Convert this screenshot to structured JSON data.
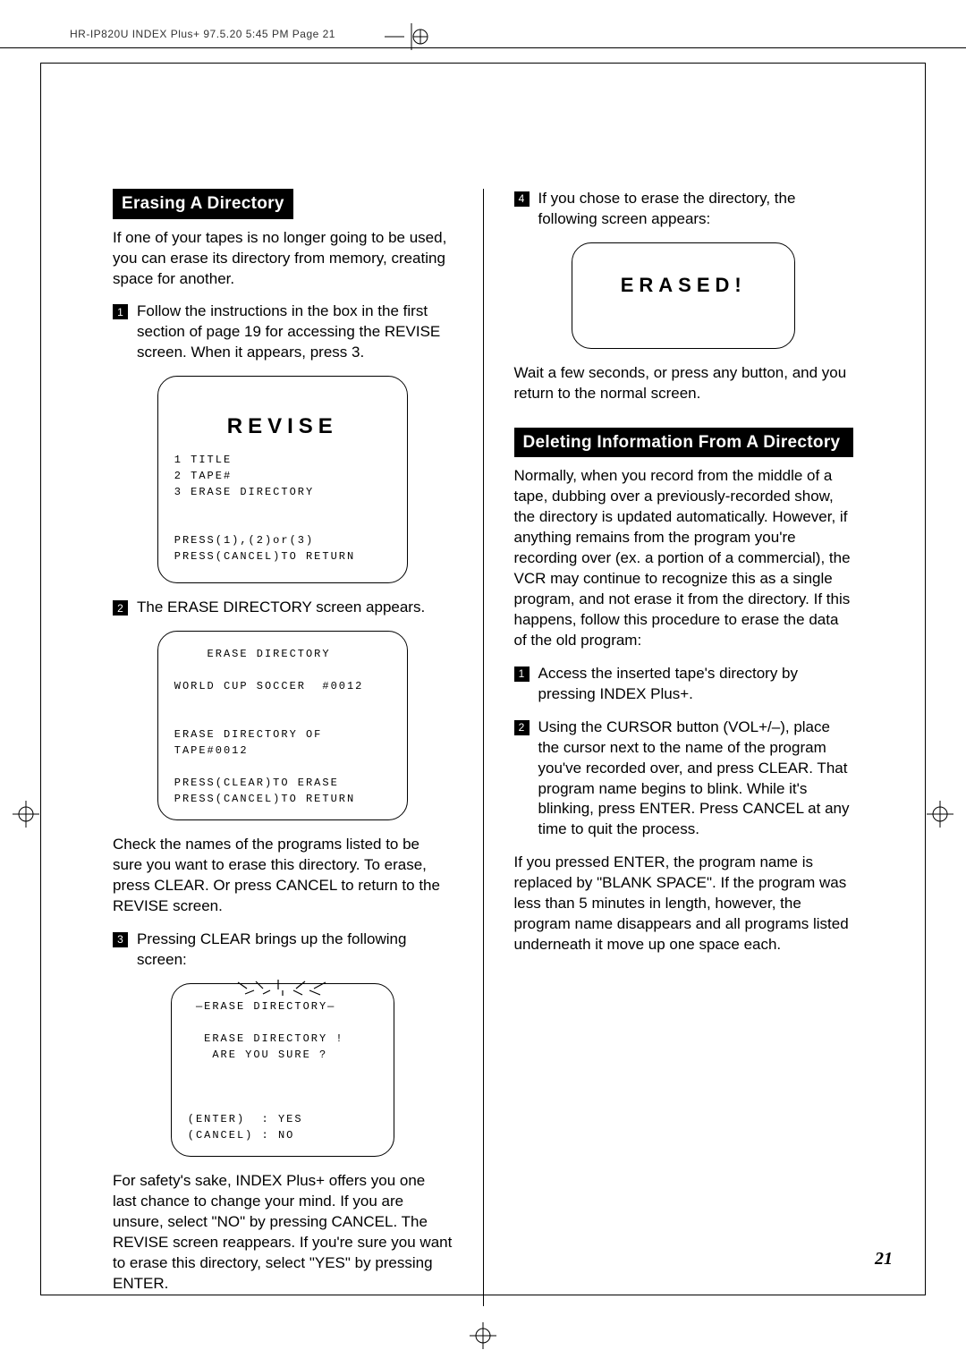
{
  "header": "HR-IP820U INDEX Plus+  97.5.20 5:45 PM  Page 21",
  "page_number": "21",
  "left": {
    "section_title": "Erasing A Directory",
    "intro": "If one of your tapes is no longer going to be used, you can erase its directory from memory, creating space for another.",
    "step1": "Follow the instructions in the box in the first section of page 19 for accessing the REVISE screen. When it appears, press 3.",
    "revise_screen": {
      "title": "REVISE",
      "body": "1 TITLE\n2 TAPE#\n3 ERASE DIRECTORY\n\n\nPRESS(1),(2)or(3)\nPRESS(CANCEL)TO RETURN"
    },
    "step2": "The ERASE DIRECTORY screen appears.",
    "erase_screen": {
      "body": "    ERASE DIRECTORY\n\nWORLD CUP SOCCER  #0012\n\n\nERASE DIRECTORY OF\nTAPE#0012\n\nPRESS(CLEAR)TO ERASE\nPRESS(CANCEL)TO RETURN"
    },
    "check_text": "Check the names of the programs listed to be sure you want to erase this directory. To erase, press CLEAR. Or press CANCEL to return to the REVISE screen.",
    "step3": "Pressing CLEAR brings up the following screen:",
    "confirm_screen": {
      "body": " —ERASE DIRECTORY—\n\n  ERASE DIRECTORY !\n   ARE YOU SURE ?\n\n\n\n(ENTER)  : YES\n(CANCEL) : NO"
    },
    "safety_text": "For safety's sake, INDEX Plus+ offers you one last chance to change your mind. If you are unsure, select \"NO\" by pressing CANCEL. The REVISE screen reappears. If you're sure you want to erase this directory, select \"YES\" by pressing ENTER."
  },
  "right": {
    "step4": "If you chose to erase the directory, the following screen appears:",
    "erased_screen": {
      "title": "ERASED!"
    },
    "wait_text": "Wait a few seconds, or press any button, and you return to the normal screen.",
    "section_title": "Deleting Information From A Directory",
    "intro": "Normally, when you record from the middle of a tape, dubbing over a previously-recorded show, the directory is updated automatically. However, if anything remains from the program you're recording over (ex. a portion of a commercial), the VCR may continue to recognize this as a single program, and not erase it from the directory. If this happens, follow this procedure to erase the data of the old program:",
    "step1": "Access the inserted tape's directory by pressing INDEX Plus+.",
    "step2": "Using the CURSOR button (VOL+/–), place the cursor next to the name of the program you've recorded over, and press CLEAR. That program name begins to blink. While it's blinking, press ENTER. Press CANCEL at any time to quit the process.",
    "blank_text": "If you pressed ENTER, the program name is replaced by \"BLANK SPACE\". If the program was less than 5 minutes in length, however, the program name disappears and all programs listed underneath it move up one space each."
  }
}
